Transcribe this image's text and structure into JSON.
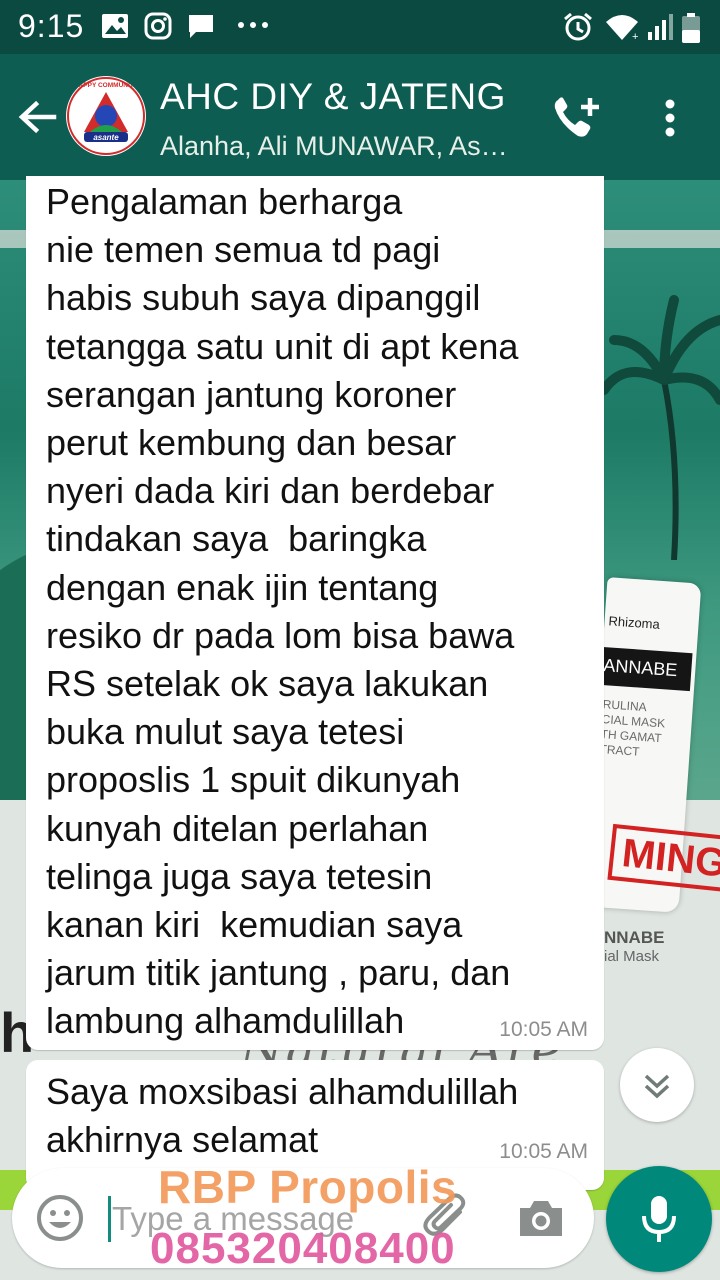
{
  "status_bar": {
    "time": "9:15",
    "icons_left": [
      "image-icon",
      "instagram-icon",
      "chat-icon",
      "more-dots-icon"
    ],
    "icons_right": [
      "alarm-icon",
      "wifi-icon",
      "signal-icon",
      "battery-icon"
    ]
  },
  "header": {
    "title": "AHC DIY & JATENG",
    "subtitle": "Alanha, Ali MUNAWAR, As…",
    "avatar_text_top": "HAPPY COMMUNITY",
    "avatar_text_bottom": "asante"
  },
  "messages": [
    {
      "text": "Pengalaman berharga\nnie temen semua td pagi\nhabis subuh saya dipanggil\ntetangga satu unit di apt kena\nserangan jantung koroner\nperut kembung dan besar\nnyeri dada kiri dan berdebar\ntindakan saya  baringka\ndengan enak ijin tentang\nresiko dr pada lom bisa bawa\nRS setelak ok saya lakukan\nbuka mulut saya tetesi\nproposlis 1 spuit dikunyah\nkunyah ditelan perlahan\ntelinga juga saya tetesin\nkanan kiri  kemudian saya\njarum titik jantung , paru, dan\nlambung alhamdulillah",
      "time": "10:05 AM"
    },
    {
      "text": "Saya moxsibasi alhamdulillah\nakhirnya selamat",
      "time": "10:05 AM"
    }
  ],
  "wallpaper": {
    "product_brand": "Rhizoma",
    "product_name": "ANNABE",
    "product_desc": "RULINA\nCIAL MASK\nTH GAMAT\nTRACT",
    "stamp": "MING",
    "label": "NNABE",
    "label_sub": "ial Mask",
    "left_text": "h",
    "script_text": "Natural Are Young"
  },
  "input": {
    "placeholder": "Type a message"
  },
  "watermark": {
    "line1": "RBP Propolis",
    "line2": "085320408400"
  },
  "colors": {
    "header": "#0e5d52",
    "status_bar": "#0b4a41",
    "accent": "#00897b",
    "watermark_orange": "#f39a5a",
    "watermark_pink": "#e15aa0"
  }
}
